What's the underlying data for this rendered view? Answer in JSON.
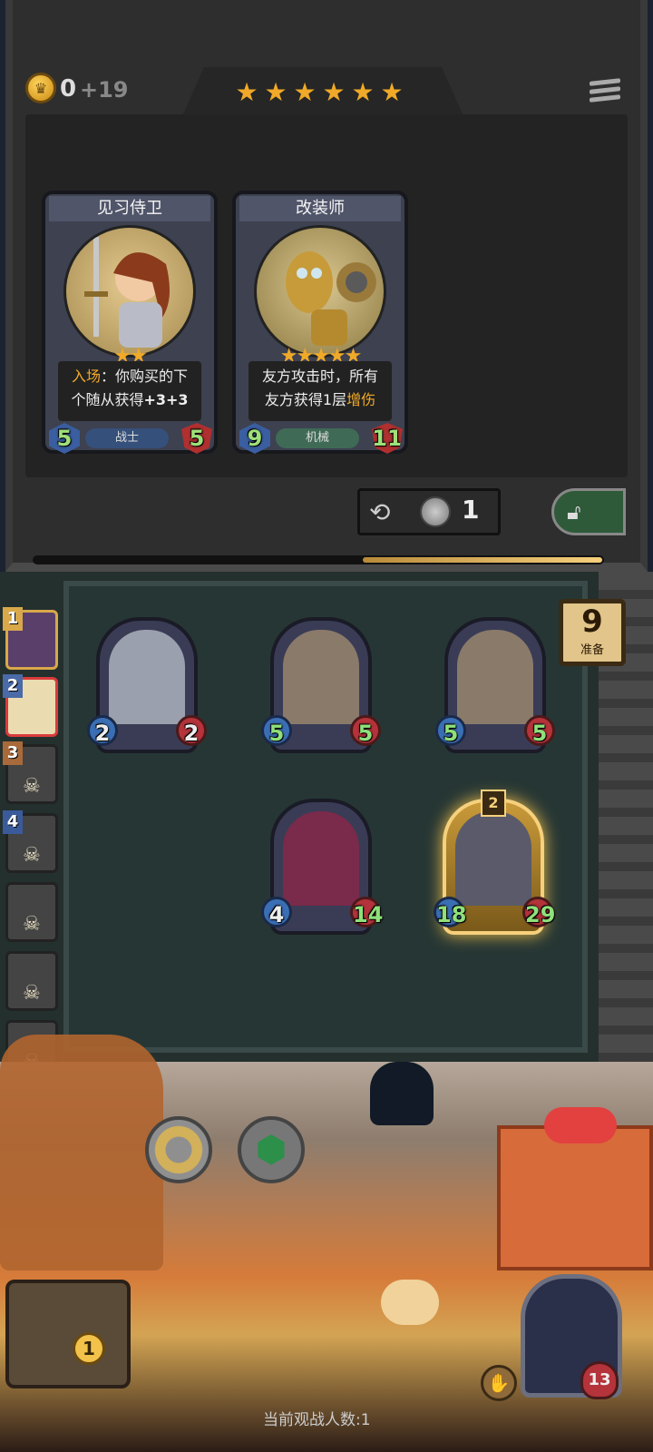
{
  "header": {
    "gold": "0",
    "gold_income": "+19",
    "tavern_stars": 6
  },
  "shop": {
    "cards": [
      {
        "name": "见习侍卫",
        "stars": "★★",
        "text_keyword": "入场",
        "text_rest_line1": "：你购买的下",
        "text_line2_prefix": "个随从获得",
        "text_line2_bold": "+3+3",
        "tribe": "战士",
        "attack": "5",
        "health": "5",
        "tribe_color": "#35507a"
      },
      {
        "name": "改装师",
        "stars": "★★★★★",
        "text_line1": "友方攻击时，所有",
        "text_line2_prefix": "友方获得1层",
        "text_line2_keyword": "增伤",
        "tribe": "机械",
        "attack": "9",
        "health": "11",
        "tribe_color": "#3f6a55"
      }
    ],
    "refresh_cost": "1"
  },
  "progress": 0.42,
  "board": {
    "ready_count": "9",
    "ready_label": "准备",
    "minions": [
      {
        "attack": "2",
        "health": "2"
      },
      {
        "attack": "5",
        "health": "5"
      },
      {
        "attack": "5",
        "health": "5"
      },
      {
        "attack": "4",
        "health": "14"
      },
      {
        "attack": "18",
        "health": "29",
        "tier": "2"
      }
    ]
  },
  "roster": [
    {
      "rank": "1"
    },
    {
      "rank": "2"
    },
    {
      "rank": "3"
    },
    {
      "rank": "4"
    },
    {
      "rank": ""
    },
    {
      "rank": ""
    },
    {
      "rank": ""
    },
    {
      "rank": ""
    }
  ],
  "bottom": {
    "tavern_tier": "1",
    "spectators": "当前观战人数:1",
    "hero_health": "13"
  }
}
